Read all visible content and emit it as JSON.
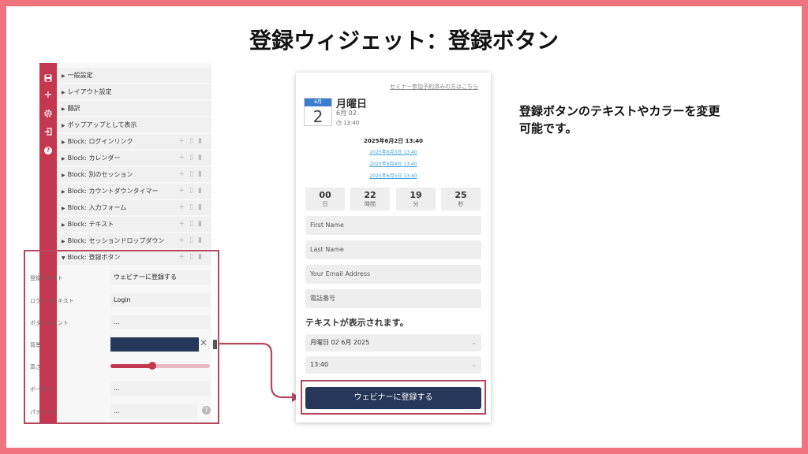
{
  "slide": {
    "title": "登録ウィジェット：登録ボタン",
    "description_line1": "登録ボタンのテキストやカラーを変更",
    "description_line2": "可能です。"
  },
  "toolbar": {
    "icons": [
      "save-icon",
      "plus-icon",
      "gear-icon",
      "exit-icon",
      "help-icon"
    ],
    "plus_glyph": "+",
    "help_glyph": "?"
  },
  "editor": {
    "rows": [
      {
        "label": "一般設定"
      },
      {
        "label": "レイアウト設定"
      },
      {
        "label": "翻訳"
      },
      {
        "label": "ポップアップとして表示"
      },
      {
        "label": "Block: ログインリンク"
      },
      {
        "label": "Block: カレンダー"
      },
      {
        "label": "Block: 別のセッション"
      },
      {
        "label": "Block: カウントダウンタイマー"
      },
      {
        "label": "Block: 入力フォーム"
      },
      {
        "label": "Block: テキスト"
      },
      {
        "label": "Block: セッションドロップダウン"
      },
      {
        "label": "Block: 登録ボタン"
      }
    ],
    "props": {
      "register_text_label": "登録テキスト",
      "register_text_value": "ウェビナーに登録する",
      "login_text_label": "ログインテキスト",
      "login_text_value": "Login",
      "font_label": "ボタンフォント",
      "font_value": "...",
      "bg_label": "背景",
      "bg_color": "#26375a",
      "height_label": "高さ",
      "height_level": 0.42,
      "border_label": "ボーダー",
      "border_value": "...",
      "padding_label": "パディング",
      "padding_value": "...",
      "clear_glyph": "✕",
      "help_glyph": "?"
    }
  },
  "preview": {
    "reg_link": "セミナー参加予約済みの方はこちら",
    "calendar": {
      "month": "6月",
      "day": "2",
      "weekday": "月曜日",
      "date": "6月 02",
      "time": "13:40"
    },
    "selected_session": "2025年6月2日 13:40",
    "alt_sessions": [
      "2025年6月3日 13:40",
      "2025年6月4日 13:40",
      "2025年6月5日 13:40"
    ],
    "countdown": [
      {
        "value": "00",
        "unit": "日"
      },
      {
        "value": "22",
        "unit": "時間"
      },
      {
        "value": "19",
        "unit": "分"
      },
      {
        "value": "25",
        "unit": "秒"
      }
    ],
    "inputs": {
      "first_name": "First Name",
      "last_name": "Last Name",
      "email": "Your Email Address",
      "phone": "電話番号"
    },
    "text_block": "テキストが表示されます。",
    "date_select": "月曜日 02 6月 2025",
    "time_select": "13:40",
    "register_button": "ウェビナーに登録する"
  },
  "colors": {
    "accent": "#c4384f",
    "button": "#26375a",
    "frame": "#f07480",
    "link": "#3aa0d8"
  }
}
